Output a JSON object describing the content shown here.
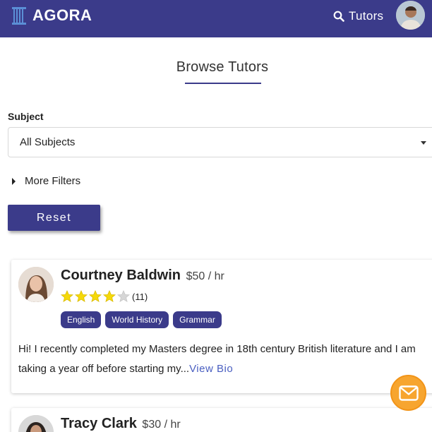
{
  "navbar": {
    "brand": "AGORA",
    "tutors_label": "Tutors",
    "colors": {
      "background": "#3b3b8a",
      "text": "#ffffff"
    }
  },
  "page": {
    "title": "Browse Tutors"
  },
  "filters": {
    "subject_label": "Subject",
    "subject_value": "All Subjects",
    "more_filters_label": "More Filters",
    "reset_label": "Reset"
  },
  "tutors": [
    {
      "name": "Courtney Baldwin",
      "rate": "$50 / hr",
      "rating": 4,
      "rating_max": 5,
      "review_count": "(11)",
      "subjects": [
        "English",
        "World History",
        "Grammar"
      ],
      "bio": "Hi! I recently completed my Masters degree in 18th century British literature and I am taking a year off before starting my...",
      "view_bio_label": "View Bio"
    },
    {
      "name": "Tracy Clark",
      "rate": "$30 / hr"
    }
  ],
  "contact_button": {
    "icon": "envelope-icon",
    "color": "#f7a52f"
  },
  "colors": {
    "accent": "#3b3b8a",
    "link": "#4a5fc1",
    "star": "#f5d90a",
    "star_empty": "#cccccc"
  }
}
